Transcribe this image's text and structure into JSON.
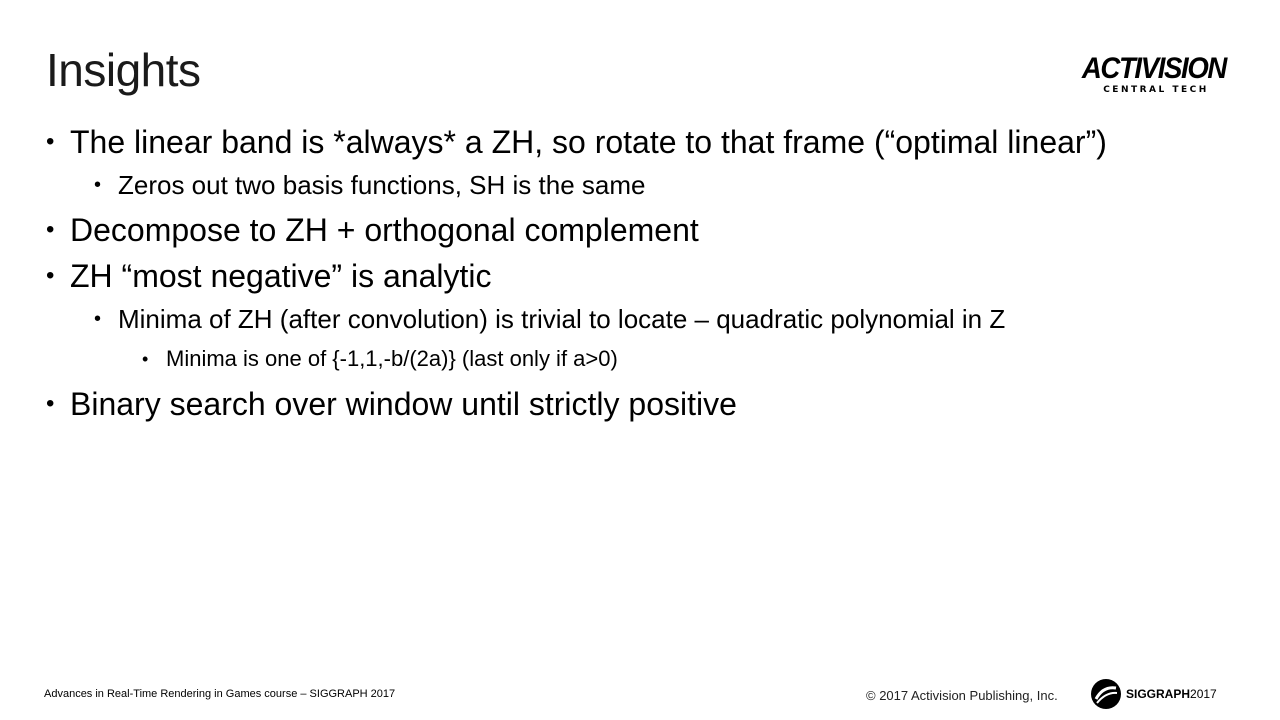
{
  "slide": {
    "title": "Insights"
  },
  "logo": {
    "wordmark": "ACTIVISION",
    "subtitle": "CENTRAL TECH"
  },
  "bullets": [
    {
      "level": 1,
      "text": "The linear band is *always* a ZH, so rotate to that frame (“optimal linear”)"
    },
    {
      "level": 2,
      "text": "Zeros out two basis functions, SH is the same"
    },
    {
      "level": 1,
      "text": "Decompose to ZH + orthogonal complement"
    },
    {
      "level": 1,
      "text": "ZH “most negative” is analytic"
    },
    {
      "level": 2,
      "text": "Minima of ZH (after convolution) is trivial to locate – quadratic polynomial in Z"
    },
    {
      "level": 3,
      "text": "Minima is one of {-1,1,-b/(2a)} (last only if a>0)"
    },
    {
      "level": 1,
      "text": "Binary search over window until strictly positive"
    }
  ],
  "bullet_glyph": "•",
  "footer": {
    "course": "Advances in Real-Time Rendering in Games course – SIGGRAPH 2017",
    "copyright": "© 2017 Activision Publishing, Inc.",
    "siggraph_word": "SIGGRAPH",
    "siggraph_year": "2017"
  }
}
